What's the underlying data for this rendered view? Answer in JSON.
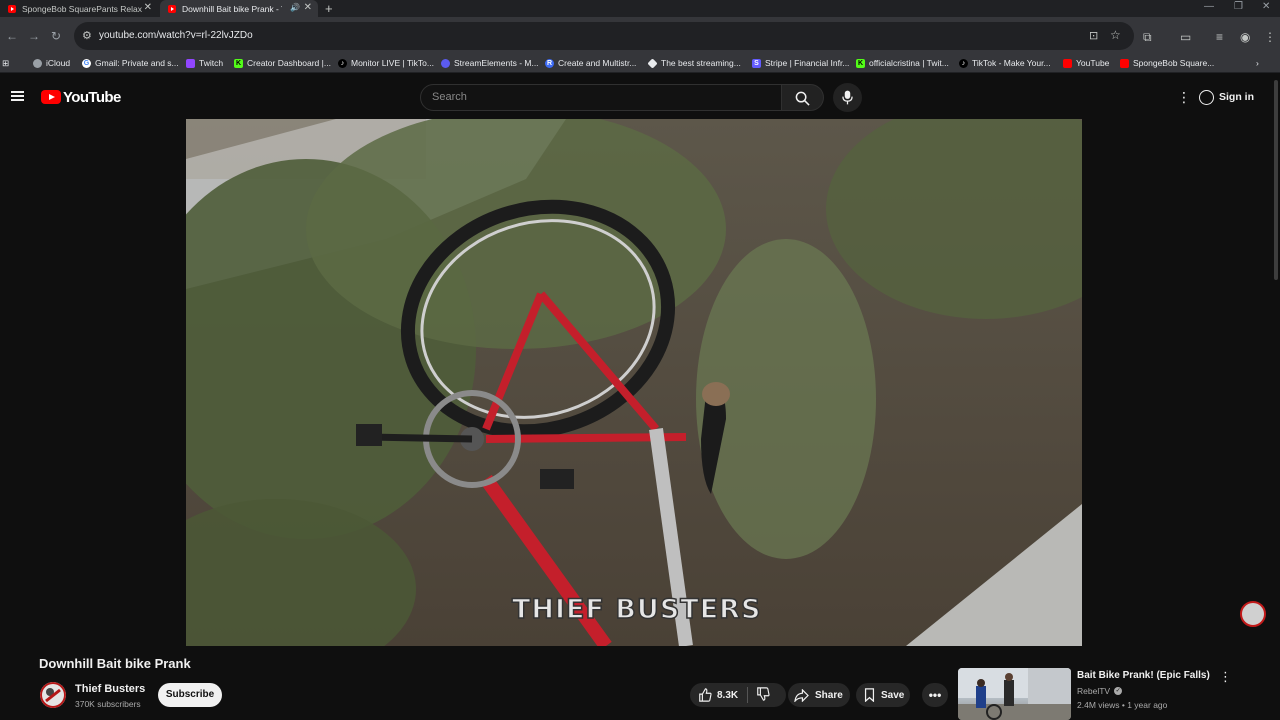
{
  "browser": {
    "tabs": [
      {
        "title": "SpongeBob SquarePants Relax",
        "active": false
      },
      {
        "title": "Downhill Bait bike Prank - Y",
        "active": true
      }
    ],
    "url": "youtube.com/watch?v=rl-22lvJZDo",
    "bookmarks": [
      {
        "label": "iCloud",
        "icon": "apple-icon",
        "color": "#9aa0a6"
      },
      {
        "label": "Gmail: Private and s...",
        "icon": "google-icon",
        "color": "#4285f4"
      },
      {
        "label": "Twitch",
        "icon": "twitch-icon",
        "color": "#9146ff"
      },
      {
        "label": "Creator Dashboard |...",
        "icon": "kick-icon",
        "color": "#53fc18"
      },
      {
        "label": "Monitor LIVE | TikTo...",
        "icon": "tiktok-icon",
        "color": "#000000"
      },
      {
        "label": "StreamElements - M...",
        "icon": "streamelements-icon",
        "color": "#5b5bf0"
      },
      {
        "label": "Create and Multistr...",
        "icon": "restream-icon",
        "color": "#3d6bf5"
      },
      {
        "label": "The best streaming...",
        "icon": "streamlabs-icon",
        "color": "#e8eaed"
      },
      {
        "label": "Stripe | Financial Infr...",
        "icon": "stripe-icon",
        "color": "#635bff"
      },
      {
        "label": "officialcristina | Twit...",
        "icon": "kick-icon",
        "color": "#53fc18"
      },
      {
        "label": "TikTok - Make Your...",
        "icon": "tiktok-icon",
        "color": "#000000"
      },
      {
        "label": "YouTube",
        "icon": "youtube-icon",
        "color": "#ff0000"
      },
      {
        "label": "SpongeBob Square...",
        "icon": "youtube-icon",
        "color": "#ff0000"
      }
    ]
  },
  "masthead": {
    "logo_text": "YouTube",
    "search_placeholder": "Search",
    "signin_label": "Sign in"
  },
  "video": {
    "watermark": "THIEF BUSTERS",
    "title": "Downhill Bait bike Prank",
    "channel_name": "Thief Busters",
    "subscribers": "370K subscribers",
    "subscribe_label": "Subscribe",
    "likes": "8.3K",
    "share_label": "Share",
    "save_label": "Save"
  },
  "recommended": [
    {
      "title": "Bait Bike Prank! (Epic Falls)",
      "channel": "RebelTV",
      "meta": "2.4M views • 1 year ago"
    }
  ],
  "colors": {
    "accent": "#ff0000",
    "background": "#0f0f0f"
  }
}
